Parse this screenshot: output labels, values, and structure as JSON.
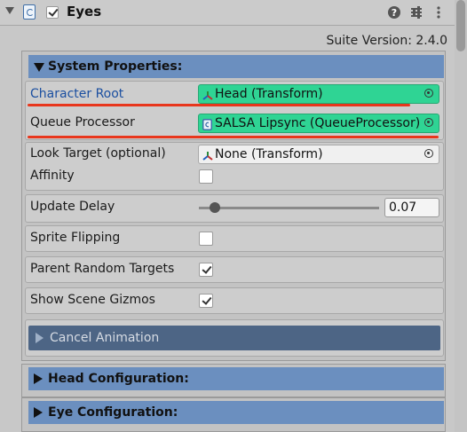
{
  "header": {
    "title": "Eyes",
    "enabled": true,
    "icons": [
      "help-icon",
      "preset-icon",
      "more-icon"
    ]
  },
  "version": "Suite Version: 2.4.0",
  "system_properties": {
    "title": "System Properties:",
    "character_root": {
      "label": "Character Root",
      "value": "Head (Transform)"
    },
    "queue_processor": {
      "label": "Queue Processor",
      "value": "SALSA Lipsync (QueueProcessor)"
    },
    "look_target": {
      "label": "Look Target (optional)",
      "value": "None (Transform)"
    },
    "affinity": {
      "label": "Affinity",
      "checked": false
    },
    "update_delay": {
      "label": "Update Delay",
      "value": "0.07",
      "slider_fraction": 0.07
    },
    "sprite_flipping": {
      "label": "Sprite Flipping",
      "checked": false
    },
    "parent_random_targets": {
      "label": "Parent Random Targets",
      "checked": true
    },
    "show_scene_gizmos": {
      "label": "Show Scene Gizmos",
      "checked": true
    },
    "cancel_animation": {
      "label": "Cancel Animation"
    }
  },
  "head_configuration": {
    "title": "Head Configuration:"
  },
  "eye_configuration": {
    "title": "Eye Configuration:"
  },
  "colors": {
    "section_bar": "#6b8fbf",
    "highlight_field": "#2fd494",
    "annotation_underline": "#e8361c",
    "cancel_bar": "#4d6585"
  }
}
